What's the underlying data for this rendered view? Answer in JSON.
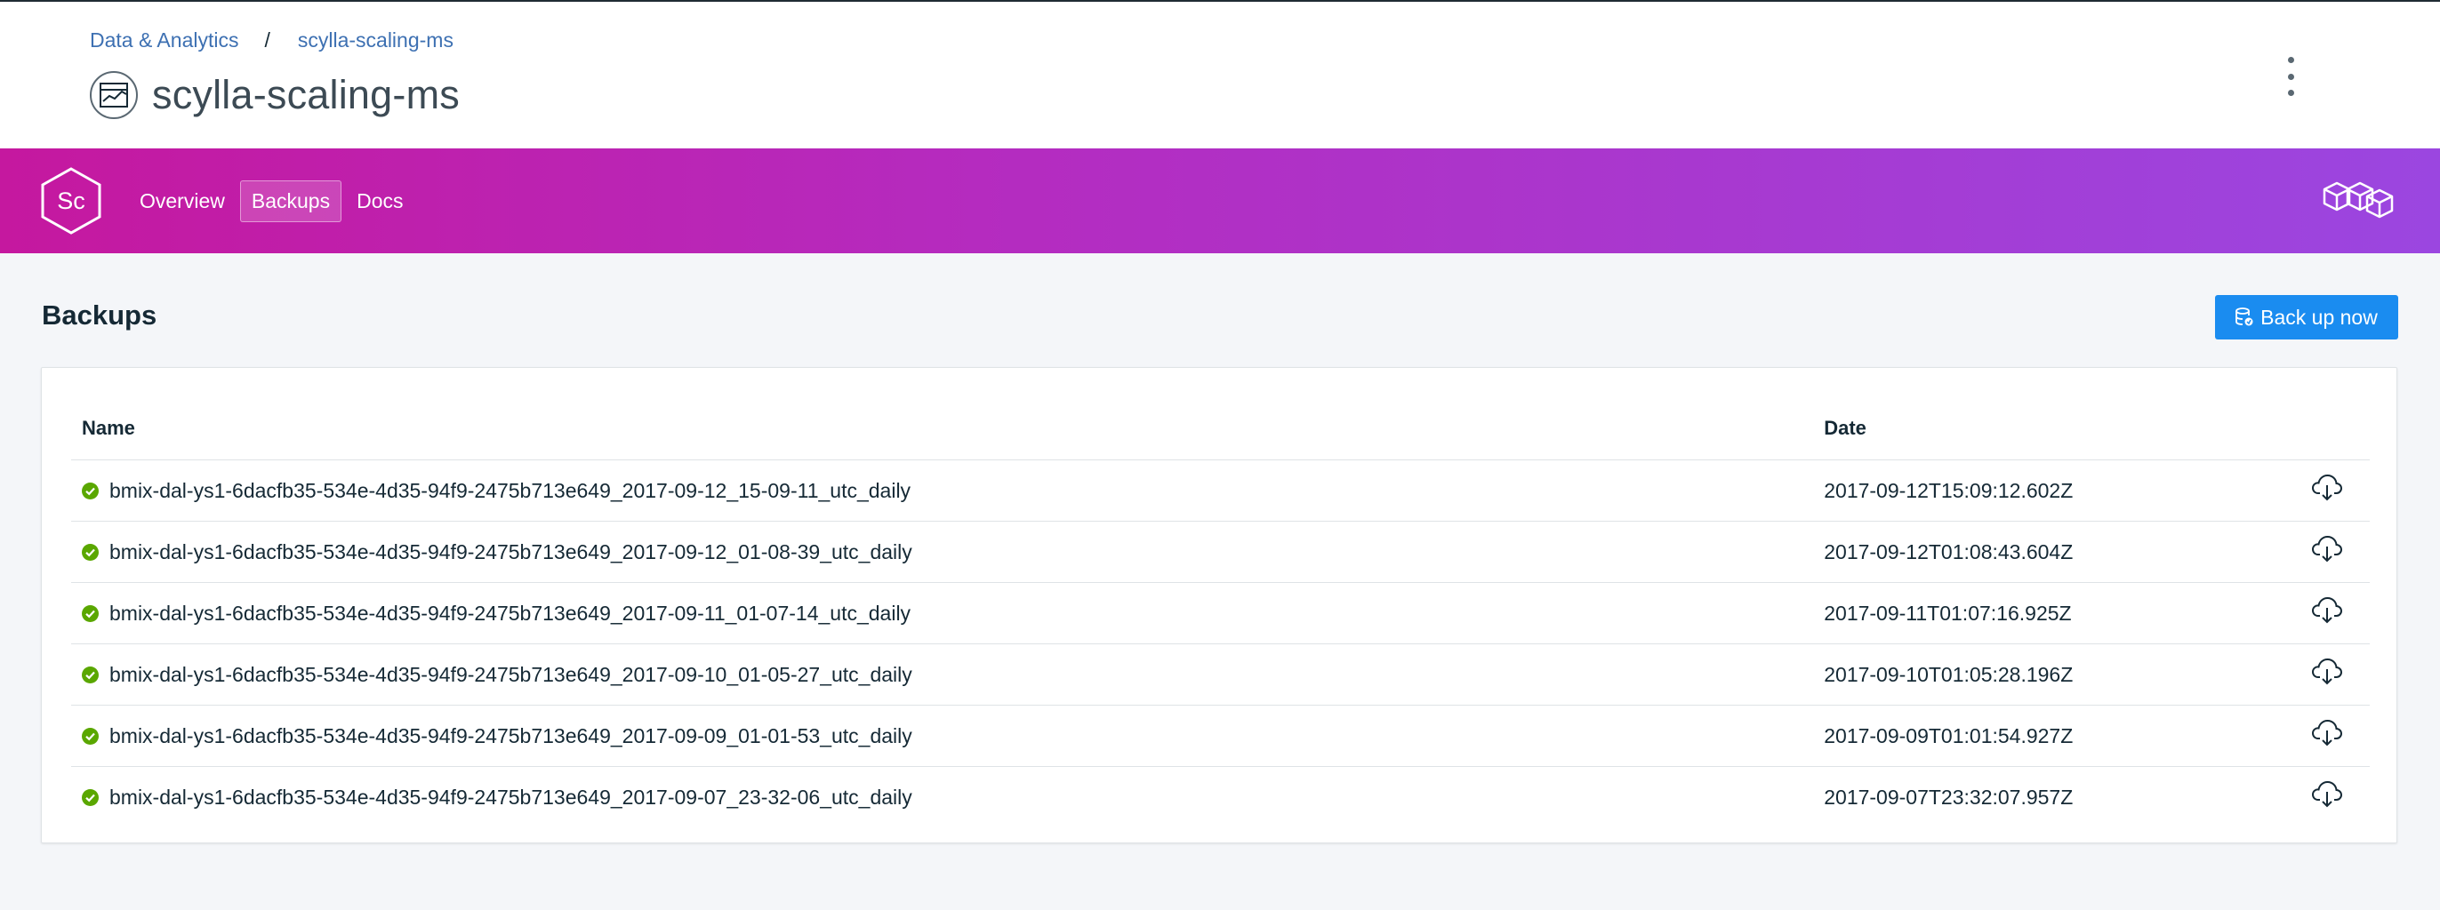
{
  "breadcrumb": {
    "parent": "Data & Analytics",
    "separator": "/",
    "current": "scylla-scaling-ms"
  },
  "header": {
    "title": "scylla-scaling-ms",
    "service_icon": "chart-icon",
    "menu_icon": "overflow-menu-icon"
  },
  "banner": {
    "logo_text": "Sc",
    "tabs": [
      {
        "label": "Overview",
        "active": false
      },
      {
        "label": "Backups",
        "active": true
      },
      {
        "label": "Docs",
        "active": false
      }
    ],
    "brand_icon": "cubes-icon",
    "gradient": [
      "#c5189f",
      "#9b46e0"
    ]
  },
  "main": {
    "title": "Backups",
    "backup_button": "Back up now",
    "accent": "#1a8cf0",
    "table": {
      "headers": {
        "name": "Name",
        "date": "Date"
      },
      "rows": [
        {
          "name": "bmix-dal-ys1-6dacfb35-534e-4d35-94f9-2475b713e649_2017-09-12_15-09-11_utc_daily",
          "date": "2017-09-12T15:09:12.602Z",
          "status": "success"
        },
        {
          "name": "bmix-dal-ys1-6dacfb35-534e-4d35-94f9-2475b713e649_2017-09-12_01-08-39_utc_daily",
          "date": "2017-09-12T01:08:43.604Z",
          "status": "success"
        },
        {
          "name": "bmix-dal-ys1-6dacfb35-534e-4d35-94f9-2475b713e649_2017-09-11_01-07-14_utc_daily",
          "date": "2017-09-11T01:07:16.925Z",
          "status": "success"
        },
        {
          "name": "bmix-dal-ys1-6dacfb35-534e-4d35-94f9-2475b713e649_2017-09-10_01-05-27_utc_daily",
          "date": "2017-09-10T01:05:28.196Z",
          "status": "success"
        },
        {
          "name": "bmix-dal-ys1-6dacfb35-534e-4d35-94f9-2475b713e649_2017-09-09_01-01-53_utc_daily",
          "date": "2017-09-09T01:01:54.927Z",
          "status": "success"
        },
        {
          "name": "bmix-dal-ys1-6dacfb35-534e-4d35-94f9-2475b713e649_2017-09-07_23-32-06_utc_daily",
          "date": "2017-09-07T23:32:07.957Z",
          "status": "success"
        }
      ],
      "status_color": "#5aa700",
      "row_icon": "cloud-download-icon"
    }
  }
}
